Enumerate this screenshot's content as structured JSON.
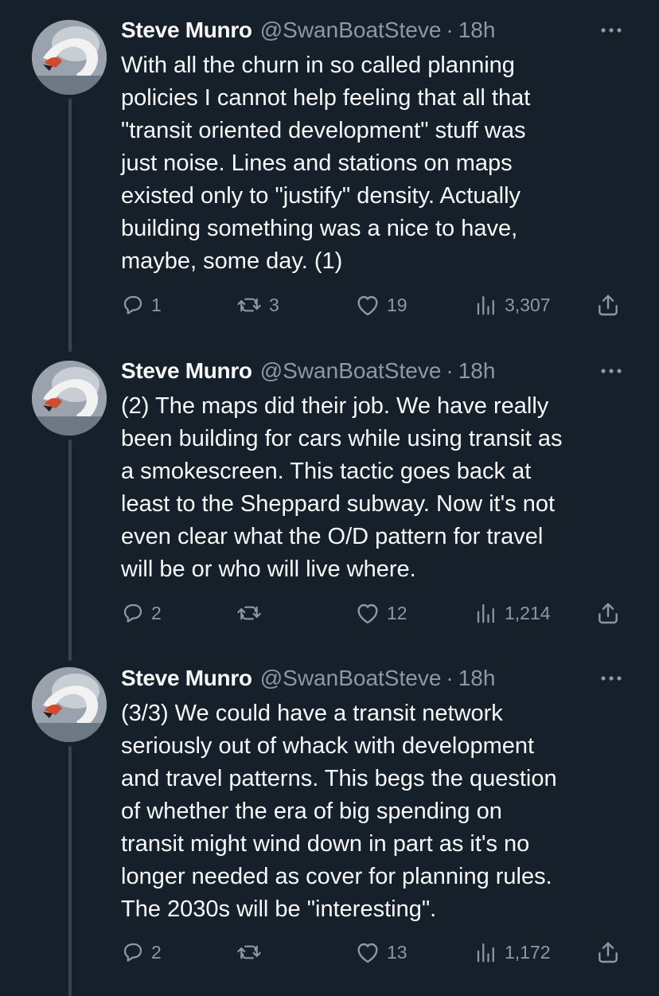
{
  "tweets": [
    {
      "author": "Steve Munro",
      "handle": "@SwanBoatSteve",
      "separator": "·",
      "time": "18h",
      "lines": [
        "With all the churn in so called planning",
        "policies I cannot help feeling that all that",
        "\"transit oriented development\" stuff was",
        "just noise. Lines and stations on maps",
        "existed only to \"justify\" density. Actually",
        "building something was a nice to have,",
        "maybe, some day. (1)"
      ],
      "replies": "1",
      "reposts": "3",
      "likes": "19",
      "views": "3,307"
    },
    {
      "author": "Steve Munro",
      "handle": "@SwanBoatSteve",
      "separator": "·",
      "time": "18h",
      "lines": [
        "(2) The maps did their job. We have really",
        "been building for cars while using transit as",
        "a smokescreen. This tactic goes back at",
        "least to the Sheppard subway. Now it's not",
        "even clear what the O/D pattern for travel",
        "will be or who will live where."
      ],
      "replies": "2",
      "reposts": "",
      "likes": "12",
      "views": "1,214"
    },
    {
      "author": "Steve Munro",
      "handle": "@SwanBoatSteve",
      "separator": "·",
      "time": "18h",
      "lines": [
        "(3/3) We could have a transit network",
        "seriously out of whack with development",
        "and travel patterns. This begs the question",
        "of whether the era of big spending on",
        "transit might wind down in part as it's no",
        "longer needed as cover for planning rules.",
        "The 2030s will be \"interesting\"."
      ],
      "replies": "2",
      "reposts": "",
      "likes": "13",
      "views": "1,172"
    }
  ],
  "icons": {
    "more": "more-icon",
    "reply": "reply-icon",
    "repost": "repost-icon",
    "like": "heart-icon",
    "views": "views-icon",
    "share": "share-icon"
  },
  "colors": {
    "background": "#15202b",
    "text": "#f7f9f9",
    "muted": "#8b98a5",
    "thread_line": "#38444d"
  }
}
